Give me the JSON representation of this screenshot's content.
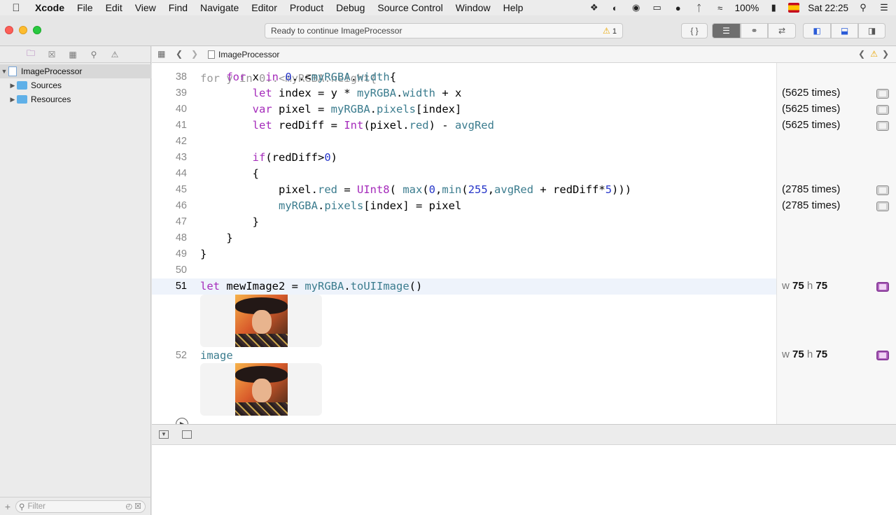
{
  "menubar": {
    "app": "Xcode",
    "items": [
      "File",
      "Edit",
      "View",
      "Find",
      "Navigate",
      "Editor",
      "Product",
      "Debug",
      "Source Control",
      "Window",
      "Help"
    ],
    "battery": "100%",
    "clock": "Sat 22:25"
  },
  "toolbar": {
    "status": "Ready to continue ImageProcessor",
    "warning_count": "1"
  },
  "navigator": {
    "project": "ImageProcessor",
    "groups": [
      "Sources",
      "Resources"
    ],
    "filter_placeholder": "Filter"
  },
  "jumpbar": {
    "file": "ImageProcessor"
  },
  "editor": {
    "lines": [
      {
        "num": "38",
        "html": "    <span class=\"kw\">for</span> x <span class=\"kw\">in</span> <span class=\"num\">0</span>..&lt;<span class=\"mb\">myRGBA</span>.<span class=\"mb\">width</span>{"
      },
      {
        "num": "39",
        "html": "        <span class=\"kw\">let</span> index = y * <span class=\"mb\">myRGBA</span>.<span class=\"mb\">width</span> + x"
      },
      {
        "num": "40",
        "html": "        <span class=\"kw\">var</span> pixel = <span class=\"mb\">myRGBA</span>.<span class=\"mb\">pixels</span>[index]"
      },
      {
        "num": "41",
        "html": "        <span class=\"kw\">let</span> redDiff = <span class=\"kw\">Int</span>(pixel.<span class=\"mb\">red</span>) - <span class=\"mb\">avgRed</span>"
      },
      {
        "num": "42",
        "html": ""
      },
      {
        "num": "43",
        "html": "        <span class=\"kw\">if</span>(redDiff&gt;<span class=\"num\">0</span>)"
      },
      {
        "num": "44",
        "html": "        {"
      },
      {
        "num": "45",
        "html": "            pixel.<span class=\"mb\">red</span> = <span class=\"kw\">UInt8</span>( <span class=\"ty\">max</span>(<span class=\"num\">0</span>,<span class=\"ty\">min</span>(<span class=\"num\">255</span>,<span class=\"mb\">avgRed</span> + redDiff*<span class=\"num\">5</span>)))"
      },
      {
        "num": "46",
        "html": "            <span class=\"mb\">myRGBA</span>.<span class=\"mb\">pixels</span>[index] = pixel"
      },
      {
        "num": "47",
        "html": "        }"
      },
      {
        "num": "48",
        "html": "    }"
      },
      {
        "num": "49",
        "html": "}"
      },
      {
        "num": "50",
        "html": ""
      },
      {
        "num": "51",
        "html": "<span class=\"kw\">let</span> mewImage2 = <span class=\"mb\">myRGBA</span>.<span class=\"mb\">toUIImage</span>()"
      },
      {
        "num": "52",
        "html": "<span class=\"mb\">image</span>"
      }
    ],
    "partial_top": "for y in 0..<myRGBA.height{"
  },
  "results": {
    "line39": "(5625 times)",
    "line40": "(5625 times)",
    "line41": "(5625 times)",
    "line45": "(2785 times)",
    "line46": "(2785 times)",
    "img51": {
      "w_label": "w",
      "w": "75",
      "h_label": "h",
      "h": "75"
    },
    "img52": {
      "w_label": "w",
      "w": "75",
      "h_label": "h",
      "h": "75"
    }
  }
}
